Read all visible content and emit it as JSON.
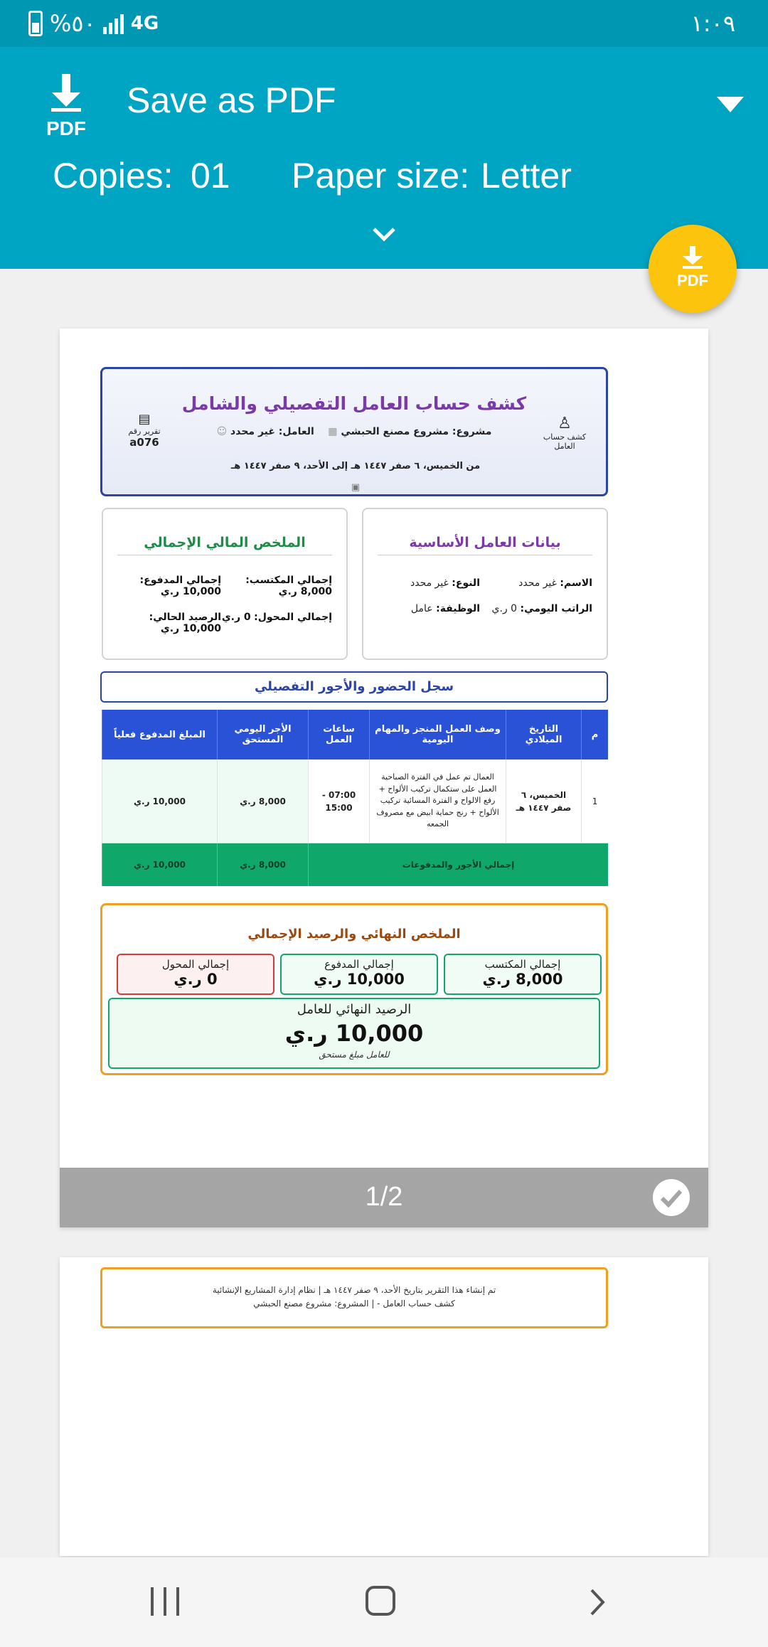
{
  "status": {
    "battery": "%٥٠",
    "network": "4G",
    "time": "١:٠٩"
  },
  "print": {
    "destination": "Save as PDF",
    "copies_label": "Copies:",
    "copies_value": "01",
    "paper_label": "Paper size:",
    "paper_value": "Letter",
    "pdf_icon_text": "PDF",
    "fab_text": "PDF"
  },
  "report": {
    "title": "كشف حساب العامل التفصيلي والشامل",
    "project": "مشروع: مشروع مصنع الحبشي",
    "worker": "العامل: غير محدد",
    "period": "من الخميس، ٦ صفر ١٤٤٧ هـ إلى الأحد، ٩ صفر ١٤٤٧ هـ",
    "report_no_label": "تقرير رقم",
    "report_no": "a076",
    "right_label": "كشف حساب العامل"
  },
  "worker_card": {
    "title": "بيانات العامل الأساسية",
    "name_label": "الاسم:",
    "name": "غير محدد",
    "type_label": "النوع:",
    "type": "غير محدد",
    "wage_label": "الراتب اليومي:",
    "wage": "0 ر.ي",
    "job_label": "الوظيفة:",
    "job": "عامل"
  },
  "fin_card": {
    "title": "الملخص المالي الإجمالي",
    "earned_label": "إجمالي المكتسب:",
    "earned": "8,000 ر.ي",
    "paid_label": "إجمالي المدفوع:",
    "paid": "10,000 ر.ي",
    "transferred_label": "إجمالي المحول:",
    "transferred": "0 ر.ي",
    "balance_label": "الرصيد الحالي:",
    "balance": "10,000 ر.ي"
  },
  "section_title": "سجل الحضور والأجور التفصيلي",
  "table": {
    "headers": [
      "م",
      "التاريخ الميلادي",
      "وصف العمل المنجز والمهام اليومية",
      "ساعات العمل",
      "الأجر اليومي المستحق",
      "المبلغ المدفوع فعلياً"
    ],
    "row": {
      "no": "1",
      "date": "الخميس، ٦ صفر ١٤٤٧ هـ",
      "desc": "العمال تم عمل في الفترة الصباحية العمل على ستكمال تركيب الألواح + رفع الالواح و الفترة المسائية تركيب الألواح + رنج حماية ابيض مع مصروف الجمعه",
      "hours": "07:00 - 15:00",
      "wage": "8,000 ر.ي",
      "paid": "10,000 ر.ي"
    },
    "footer_label": "إجمالي الأجور والمدفوعات",
    "footer_wage": "8,000 ر.ي",
    "footer_paid": "10,000 ر.ي"
  },
  "summary": {
    "title": "الملخص النهائي والرصيد الإجمالي",
    "earned_label": "إجمالي المكتسب",
    "earned": "8,000 ر.ي",
    "paid_label": "إجمالي المدفوع",
    "paid": "10,000 ر.ي",
    "transferred_label": "إجمالي المحول",
    "transferred": "0 ر.ي",
    "final_label": "الرصيد النهائي للعامل",
    "final_value": "10,000 ر.ي",
    "final_note": "للعامل مبلغ مستحق"
  },
  "page_indicator": "1/2",
  "footer": {
    "line1": "تم إنشاء هذا التقرير بتاريخ الأحد، ٩ صفر ١٤٤٧ هـ | نظام إدارة المشاريع الإنشائية",
    "line2": "كشف حساب العامل - | المشروع: مشروع مصنع الحبشي"
  },
  "colors": {
    "header": "#00a5c4",
    "fab": "#fdc40e",
    "table_header": "#2a52d6",
    "table_footer": "#10a86a"
  }
}
